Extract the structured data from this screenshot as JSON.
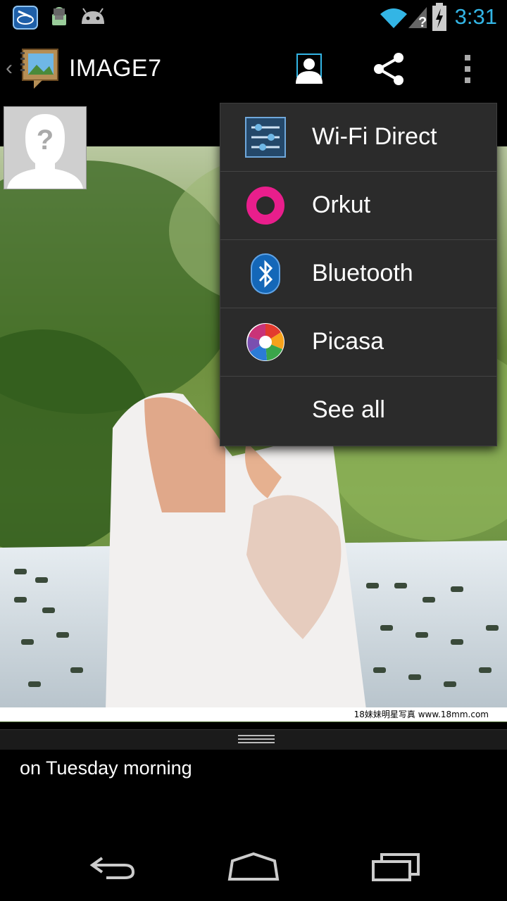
{
  "status_bar": {
    "time": "3:31",
    "icons": [
      "intel-app-icon",
      "android-debug-icon",
      "android-robot-icon",
      "wifi-icon",
      "no-signal-icon",
      "battery-charging-icon"
    ]
  },
  "action_bar": {
    "title": "IMAGE7",
    "actions": [
      "contact-icon",
      "share-icon",
      "overflow-menu-icon"
    ]
  },
  "photo": {
    "watermark": "18妹妹明星写真 www.18mm.com"
  },
  "details": {
    "caption": "on Tuesday morning"
  },
  "share_menu": {
    "items": [
      {
        "label": "Wi-Fi Direct",
        "icon": "wifi-direct-icon"
      },
      {
        "label": "Orkut",
        "icon": "orkut-icon"
      },
      {
        "label": "Bluetooth",
        "icon": "bluetooth-icon"
      },
      {
        "label": "Picasa",
        "icon": "picasa-icon"
      },
      {
        "label": "See all",
        "icon": ""
      }
    ]
  },
  "nav_bar": {
    "buttons": [
      "back-icon",
      "home-icon",
      "recent-apps-icon"
    ]
  },
  "colors": {
    "accent": "#33b5e5",
    "menu_bg": "#2b2b2b",
    "orkut_pink": "#e91e8c"
  }
}
